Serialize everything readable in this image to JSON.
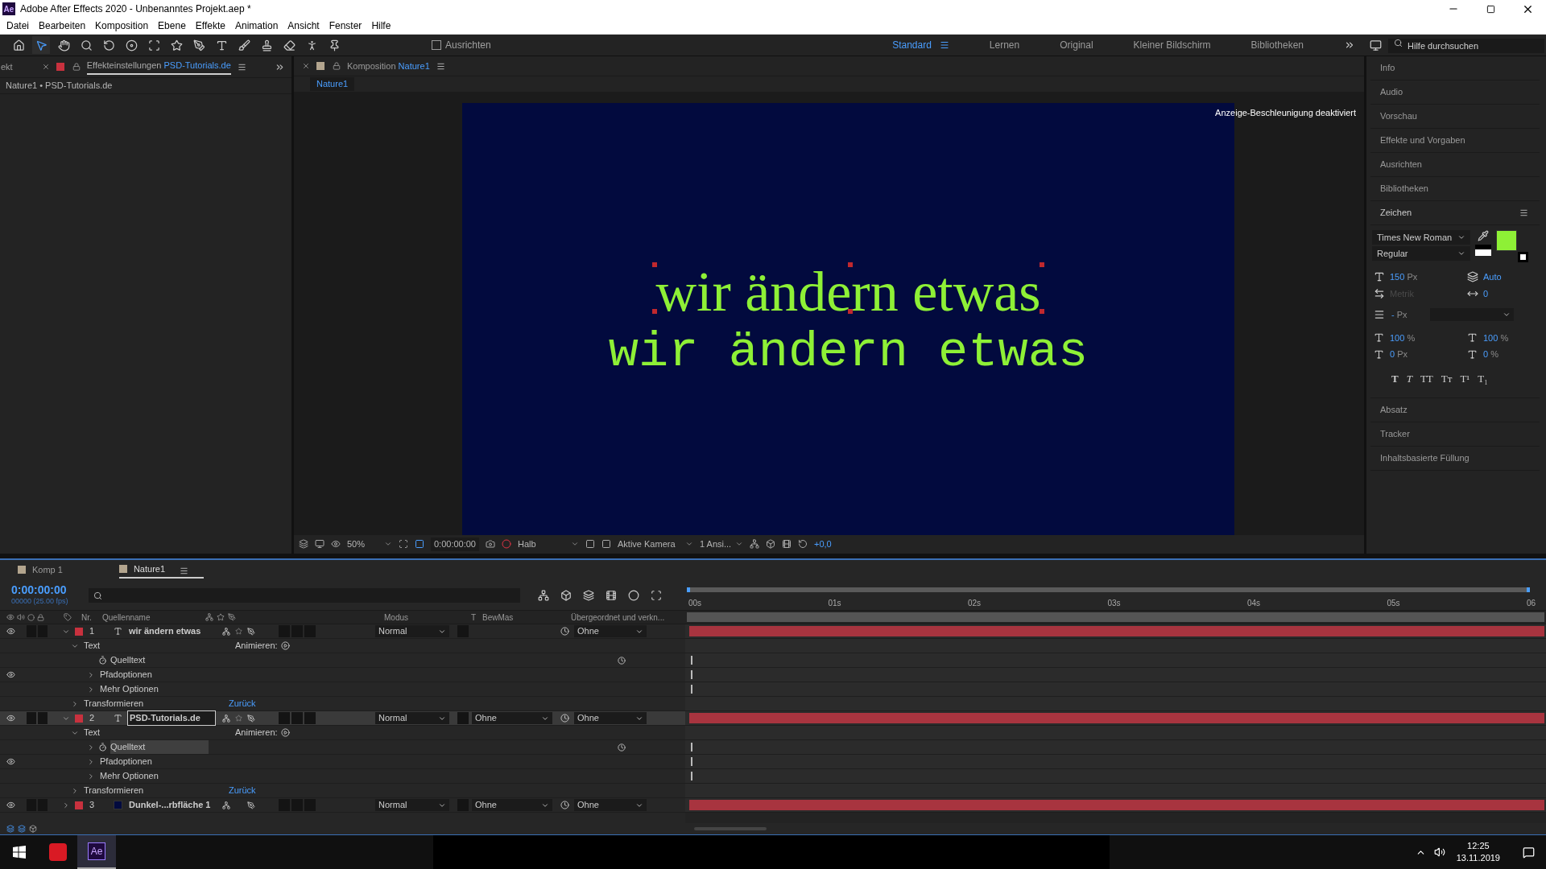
{
  "window": {
    "title": "Adobe After Effects 2020 - Unbenanntes Projekt.aep *",
    "app_badge": "Ae"
  },
  "menu": [
    "Datei",
    "Bearbeiten",
    "Komposition",
    "Ebene",
    "Effekte",
    "Animation",
    "Ansicht",
    "Fenster",
    "Hilfe"
  ],
  "toolbar": {
    "align": {
      "label": "Ausrichten",
      "checked": false
    }
  },
  "workspaces": [
    {
      "label": "Standard",
      "selected": true
    },
    {
      "label": "Lernen",
      "selected": false
    },
    {
      "label": "Original",
      "selected": false
    },
    {
      "label": "Kleiner Bildschirm",
      "selected": false
    },
    {
      "label": "Bibliotheken",
      "selected": false
    }
  ],
  "help_search": {
    "placeholder": "Hilfe durchsuchen"
  },
  "effects_panel": {
    "cut_tab": "ekt",
    "title": "Effekteinstellungen",
    "layer": "PSD-Tutorials.de",
    "breadcrumb": "Nature1 • PSD-Tutorials.de"
  },
  "composition_panel": {
    "title": "Komposition",
    "name": "Nature1",
    "tab": "Nature1",
    "notice": "Anzeige-Beschleunigung deaktiviert",
    "lines": [
      {
        "text": "wir ändern etwas",
        "kind": "serif",
        "selected": true
      },
      {
        "text": "wir ändern etwas",
        "kind": "mono",
        "selected": false
      }
    ],
    "viewer_toolbar": {
      "zoom": "50%",
      "time": "0:00:00:00",
      "resolution": "Halb",
      "camera": "Aktive Kamera",
      "views": "1 Ansi...",
      "exposure": "+0,0"
    }
  },
  "right_panel": {
    "sections_top": [
      "Info",
      "Audio",
      "Vorschau",
      "Effekte und Vorgaben",
      "Ausrichten",
      "Bibliotheken"
    ],
    "character": {
      "title": "Zeichen",
      "font": "Times New Roman",
      "style": "Regular",
      "fields": [
        {
          "value": "150",
          "unit": "Px",
          "disabled": false
        },
        {
          "value": "Auto",
          "disabled": false
        },
        {
          "value": "Metrik",
          "disabled": true
        },
        {
          "value": "0",
          "disabled": false
        }
      ],
      "leading": {
        "value": "-",
        "unit": "Px"
      },
      "scales": [
        {
          "value": "100",
          "unit": "%"
        },
        {
          "value": "100",
          "unit": "%"
        },
        {
          "value": "0",
          "unit": "Px"
        },
        {
          "value": "0",
          "unit": "%"
        }
      ],
      "style_buttons": [
        "T",
        "T",
        "TT",
        "Tт",
        "T¹",
        "T₁"
      ]
    },
    "sections_bottom": [
      "Absatz",
      "Tracker",
      "Inhaltsbasierte Füllung"
    ]
  },
  "timeline": {
    "tabs": [
      {
        "label": "Komp 1",
        "selected": false
      },
      {
        "label": "Nature1",
        "selected": true
      }
    ],
    "timecode": "0:00:00:00",
    "fps": "00000 (25.00 fps)",
    "columns": [
      "Nr.",
      "Quellenname",
      "Modus",
      "T",
      "BewMas",
      "Übergeordnet und verkn..."
    ],
    "ruler": [
      "00s",
      "01s",
      "02s",
      "03s",
      "04s",
      "05s",
      "06"
    ],
    "layers": [
      {
        "number": "1",
        "name": "wir ändern etwas",
        "kind": "text",
        "mode": "Normal",
        "parent": "Ohne",
        "expanded": true,
        "selected": false,
        "editing": false,
        "properties": [
          {
            "label": "Text",
            "expanded": true,
            "action": "Animieren:",
            "children": [
              {
                "label": "Quelltext",
                "kind": "stopwatch",
                "selected": false
              },
              {
                "label": "Pfadoptionen",
                "expanded": false,
                "visible_eye": true
              },
              {
                "label": "Mehr Optionen",
                "expanded": false
              }
            ]
          },
          {
            "label": "Transformieren",
            "expanded": false,
            "link": "Zurück"
          }
        ]
      },
      {
        "number": "2",
        "name": "PSD-Tutorials.de",
        "kind": "text",
        "mode": "Normal",
        "matte": "Ohne",
        "parent": "Ohne",
        "expanded": true,
        "selected": true,
        "editing": true,
        "properties": [
          {
            "label": "Text",
            "expanded": true,
            "action": "Animieren:",
            "children": [
              {
                "label": "Quelltext",
                "kind": "stopwatch",
                "expanded": false,
                "selected": true
              },
              {
                "label": "Pfadoptionen",
                "expanded": false,
                "visible_eye": true
              },
              {
                "label": "Mehr Optionen",
                "expanded": false
              }
            ]
          },
          {
            "label": "Transformieren",
            "expanded": false,
            "link": "Zurück"
          }
        ]
      },
      {
        "number": "3",
        "name": "Dunkel-...rbfläche 1",
        "kind": "solid",
        "mode": "Normal",
        "matte": "Ohne",
        "parent": "Ohne",
        "expanded": false,
        "selected": false,
        "editing": false
      }
    ]
  },
  "taskbar": {
    "app": "Ae",
    "time": "12:25",
    "date": "13.11.2019"
  }
}
